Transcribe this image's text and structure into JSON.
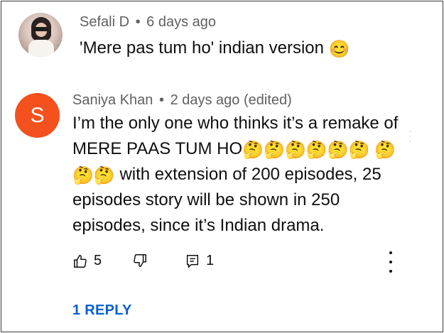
{
  "comment1": {
    "author": "Sefali D",
    "separator": "•",
    "time": "6 days ago",
    "text": "'Mere pas tum ho' indian version",
    "emoji": "😊"
  },
  "comment2": {
    "author": "Saniya Khan",
    "separator": "•",
    "time": "2 days ago (edited)",
    "avatar_letter": "S",
    "avatar_color": "#f4511e",
    "text_part1": "I’m the only one who thinks it’s a remake of MERE PAAS TUM HO",
    "thinking_emoji": "🤔",
    "text_part2": "with extension of 200 episodes, 25 episodes story will be shown in 250 episodes, since it’s Indian drama.",
    "like_count": "5",
    "reply_count": "1",
    "replies_link": "1 REPLY"
  },
  "icons": {
    "like": "thumbs-up-icon",
    "dislike": "thumbs-down-icon",
    "reply": "comment-reply-icon",
    "more": "more-vert-icon"
  },
  "colors": {
    "link": "#065fd4",
    "meta": "#606060",
    "text": "#0f0f0f"
  }
}
